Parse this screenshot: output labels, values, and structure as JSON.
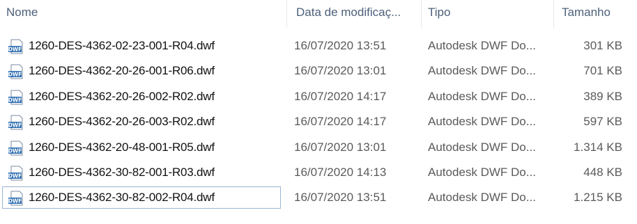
{
  "columns": {
    "name": "Nome",
    "date": "Data de modificaç...",
    "type": "Tipo",
    "size": "Tamanho"
  },
  "file_icon": "dwf-file-icon",
  "files": [
    {
      "name": "1260-DES-4362-02-23-001-R04.dwf",
      "date": "16/07/2020 13:51",
      "type": "Autodesk DWF Do...",
      "size": "301 KB"
    },
    {
      "name": "1260-DES-4362-20-26-001-R06.dwf",
      "date": "16/07/2020 13:01",
      "type": "Autodesk DWF Do...",
      "size": "701 KB"
    },
    {
      "name": "1260-DES-4362-20-26-002-R02.dwf",
      "date": "16/07/2020 14:17",
      "type": "Autodesk DWF Do...",
      "size": "389 KB"
    },
    {
      "name": "1260-DES-4362-20-26-003-R02.dwf",
      "date": "16/07/2020 14:17",
      "type": "Autodesk DWF Do...",
      "size": "597 KB"
    },
    {
      "name": "1260-DES-4362-20-48-001-R05.dwf",
      "date": "16/07/2020 13:01",
      "type": "Autodesk DWF Do...",
      "size": "1.314 KB"
    },
    {
      "name": "1260-DES-4362-30-82-001-R03.dwf",
      "date": "16/07/2020 14:13",
      "type": "Autodesk DWF Do...",
      "size": "448 KB"
    },
    {
      "name": "1260-DES-4362-30-82-002-R04.dwf",
      "date": "16/07/2020 13:51",
      "type": "Autodesk DWF Do...",
      "size": "1.215 KB"
    }
  ]
}
